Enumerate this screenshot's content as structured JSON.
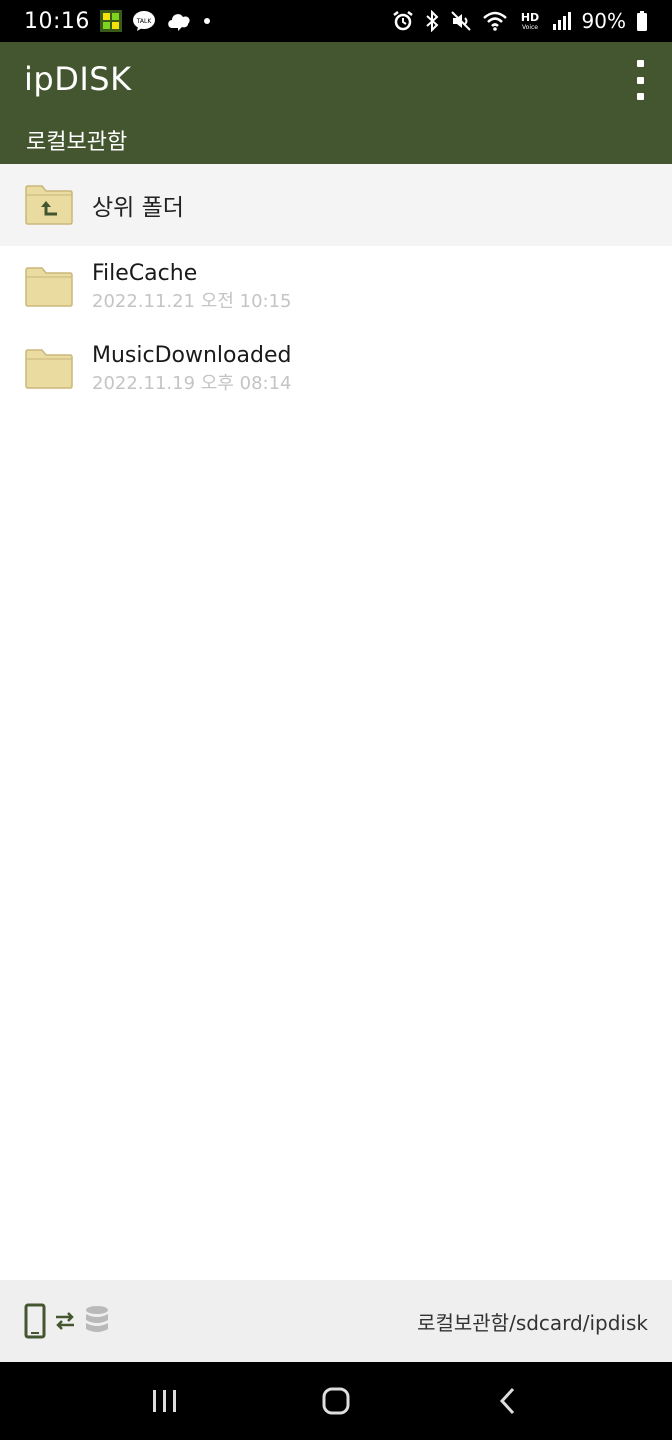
{
  "status_bar": {
    "time": "10:16",
    "battery": "90%",
    "icons": [
      "grid-app-icon",
      "kakaotalk-icon",
      "cloud-chat-icon",
      "dot-icon",
      "alarm-icon",
      "bluetooth-icon",
      "mute-icon",
      "wifi-icon",
      "hd-voice-icon",
      "signal-icon",
      "battery-icon"
    ]
  },
  "app_bar": {
    "title": "ipDISK",
    "subtitle": "로컬보관함",
    "menu_icon": "more-vert-icon"
  },
  "parent_folder": {
    "label": "상위 폴더",
    "icon": "folder-up-icon"
  },
  "files": [
    {
      "name": "FileCache",
      "date": "2022.11.21 오전 10:15",
      "icon": "folder-icon"
    },
    {
      "name": "MusicDownloaded",
      "date": "2022.11.19 오후 08:14",
      "icon": "folder-icon"
    }
  ],
  "bottom_bar": {
    "path": "로컬보관함/sdcard/ipdisk",
    "icons": [
      "phone-icon",
      "swap-icon",
      "database-icon"
    ]
  },
  "nav_bar": {
    "buttons": [
      "recent-apps-icon",
      "home-icon",
      "back-icon"
    ]
  },
  "colors": {
    "app_bar": "#44562f",
    "folder": "#eadba1",
    "accent": "#44562f"
  }
}
